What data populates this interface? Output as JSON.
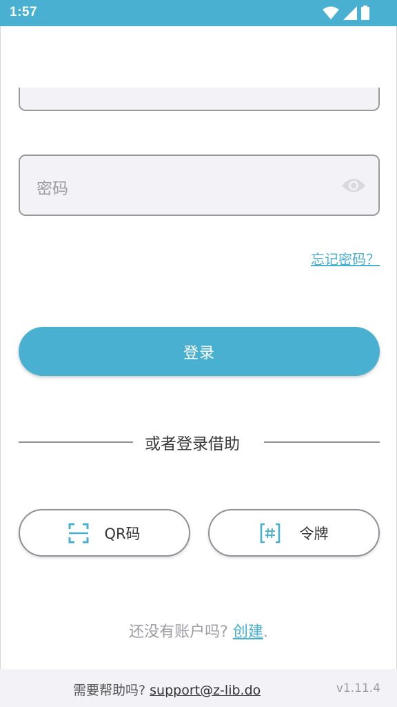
{
  "status_bar": {
    "time": "1:57",
    "icons": [
      "wifi-icon",
      "signal-icon",
      "battery-icon"
    ]
  },
  "form": {
    "password_placeholder": "密码",
    "forgot_password": "忘记密码？",
    "login_button": "登录"
  },
  "divider_text": "或者登录借助",
  "alt_login": {
    "qr_label": "QR码",
    "token_label": "令牌"
  },
  "signup": {
    "prompt": "还没有账户吗?",
    "link": "创建",
    "suffix": "."
  },
  "footer": {
    "help_text": "需要帮助吗?",
    "email": "support@z-lib.do",
    "version": "v1.11.4"
  },
  "colors": {
    "accent": "#49b0d1",
    "field_bg": "#f3f3f7",
    "border": "#9a9a9e"
  }
}
